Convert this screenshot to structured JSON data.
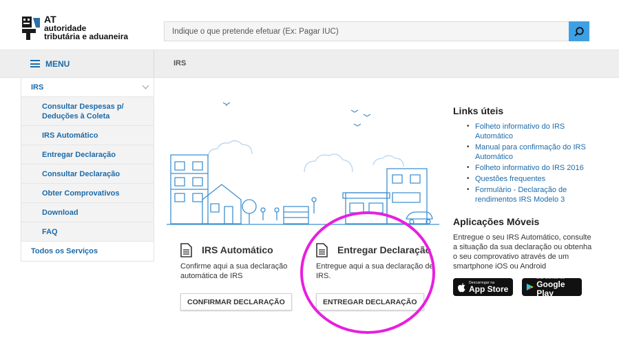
{
  "header": {
    "logo": {
      "short": "AT",
      "line1": "autoridade",
      "line2": "tributária e aduaneira"
    },
    "search": {
      "placeholder": "Indique o que pretende efetuar (Ex: Pagar IUC)",
      "icon": "search-icon"
    }
  },
  "nav": {
    "menu_label": "MENU",
    "breadcrumb": "IRS"
  },
  "sidebar": {
    "items": [
      {
        "label": "IRS",
        "level": "top"
      },
      {
        "label": "Consultar Despesas p/ Deduções à Coleta",
        "level": "sub"
      },
      {
        "label": "IRS Automático",
        "level": "sub"
      },
      {
        "label": "Entregar Declaração",
        "level": "sub"
      },
      {
        "label": "Consultar Declaração",
        "level": "sub"
      },
      {
        "label": "Obter Comprovativos",
        "level": "sub"
      },
      {
        "label": "Download",
        "level": "sub"
      },
      {
        "label": "FAQ",
        "level": "sub"
      },
      {
        "label": "Todos os Serviços",
        "level": "top"
      }
    ]
  },
  "cards": [
    {
      "title": "IRS Automático",
      "description": "Confirme aqui a sua declaração automática de IRS",
      "button": "CONFIRMAR DECLARAÇÃO"
    },
    {
      "title": "Entregar Declaração",
      "description": "Entregue aqui a sua declaração de IRS.",
      "button": "ENTREGAR DECLARAÇÃO"
    }
  ],
  "links": {
    "title": "Links úteis",
    "items": [
      "Folheto informativo do IRS Automático",
      "Manual para confirmação do IRS Automático",
      "Folheto informativo do IRS 2016",
      "Questões frequentes",
      "Formulário - Declaração de rendimentos IRS Modelo 3"
    ]
  },
  "apps": {
    "title": "Aplicações Móveis",
    "description": "Entregue o seu IRS Automático, consulte a situação da sua declaração ou obtenha o seu comprovativo através de um smartphone iOS ou Android",
    "app_store": {
      "small": "Descarregar na",
      "big": "App Store"
    },
    "google_play": {
      "small": "DISPONÍVEL NO",
      "big": "Google Play"
    }
  },
  "colors": {
    "brand_blue": "#1c6aa8",
    "search_button": "#3ea0e4",
    "highlight": "#e81ee0",
    "illustration": "#3d8fd0"
  }
}
